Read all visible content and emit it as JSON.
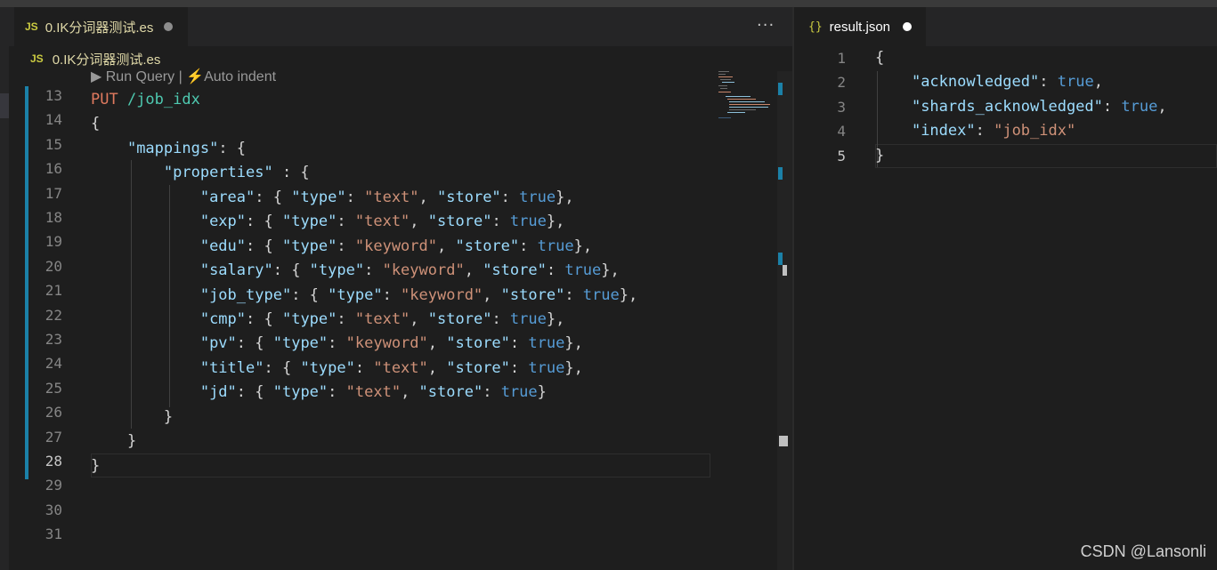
{
  "left_editor": {
    "tab": {
      "icon": "JS",
      "label": "0.IK分词器测试.es",
      "dirty": true
    },
    "more_actions": "···",
    "breadcrumb": {
      "icon": "JS",
      "label": "0.IK分词器测试.es"
    },
    "codelens": "▶ Run Query | ⚡Auto indent",
    "line_numbers": [
      "13",
      "14",
      "15",
      "16",
      "17",
      "18",
      "19",
      "20",
      "21",
      "22",
      "23",
      "24",
      "25",
      "26",
      "27",
      "28",
      "29",
      "30",
      "31"
    ],
    "active_line": "28",
    "code": {
      "l13": {
        "method": "PUT",
        "path": " /job_idx"
      },
      "l14": "{",
      "l15": {
        "indent": "    ",
        "key": "\"mappings\"",
        "rest": ": {"
      },
      "l16": {
        "indent": "        ",
        "key": "\"properties\"",
        "rest": " : {"
      },
      "fields": [
        {
          "name": "\"area\"",
          "type": "\"text\"",
          "store": "true",
          "tail": "},"
        },
        {
          "name": "\"exp\"",
          "type": "\"text\"",
          "store": "true",
          "tail": "},"
        },
        {
          "name": "\"edu\"",
          "type": "\"keyword\"",
          "store": "true",
          "tail": "},"
        },
        {
          "name": "\"salary\"",
          "type": "\"keyword\"",
          "store": "true",
          "tail": "},"
        },
        {
          "name": "\"job_type\"",
          "type": "\"keyword\"",
          "store": "true",
          "tail": "},"
        },
        {
          "name": "\"cmp\"",
          "type": "\"text\"",
          "store": "true",
          "tail": "},"
        },
        {
          "name": "\"pv\"",
          "type": "\"keyword\"",
          "store": "true",
          "tail": "},"
        },
        {
          "name": "\"title\"",
          "type": "\"text\"",
          "store": "true",
          "tail": "},"
        },
        {
          "name": "\"jd\"",
          "type": "\"text\"",
          "store": "true",
          "tail": "}"
        }
      ],
      "type_key": "\"type\"",
      "store_key": "\"store\"",
      "l26": "        }",
      "l27": "    }",
      "l28": "}"
    }
  },
  "right_editor": {
    "tab": {
      "icon": "{}",
      "label": "result.json",
      "dirty": true
    },
    "line_numbers": [
      "1",
      "2",
      "3",
      "4",
      "5"
    ],
    "active_line": "5",
    "lines": [
      {
        "text": "{"
      },
      {
        "key": "\"acknowledged\"",
        "value": "true",
        "tail": ","
      },
      {
        "key": "\"shards_acknowledged\"",
        "value": "true",
        "tail": ","
      },
      {
        "key": "\"index\"",
        "value": "\"job_idx\"",
        "tail": ""
      },
      {
        "text": "}"
      }
    ]
  },
  "watermark": "CSDN @Lansonli",
  "colors": {
    "background": "#1e1e1e",
    "method": "#e07a5f",
    "path": "#4ec9b0",
    "key": "#9cdcfe",
    "string": "#ce9178",
    "boolean": "#569cd6",
    "modified_bar": "#1b81a8"
  }
}
